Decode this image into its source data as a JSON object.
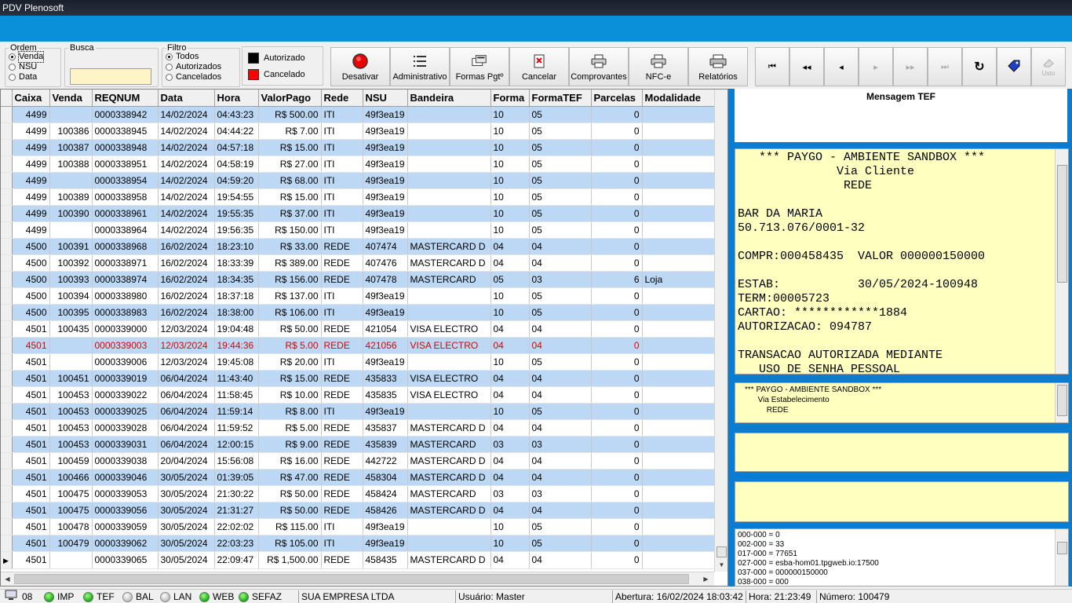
{
  "window": {
    "title": "PDV Plenosoft"
  },
  "ordem": {
    "label": "Ordem",
    "options": [
      "Venda",
      "NSU",
      "Data"
    ],
    "selected": 0
  },
  "busca": {
    "label": "Busca",
    "value": ""
  },
  "filtro": {
    "label": "Filtro",
    "options": [
      "Todos",
      "Autorizados",
      "Cancelados"
    ],
    "selected": 0
  },
  "legend": {
    "autorizado": "Autorizado",
    "cancelado": "Cancelado",
    "autorizado_color": "#000000",
    "cancelado_color": "#ff0000"
  },
  "toolbar": {
    "desativar": "Desativar",
    "administrativo": "Administrativo",
    "formas_pgt": "Formas Pgtº",
    "cancelar": "Cancelar",
    "comprovantes": "Comprovantes",
    "nfce": "NFC-e",
    "relatorios": "Relatórios"
  },
  "nav": {
    "disabled_label": "Usto"
  },
  "grid": {
    "columns": [
      "Caixa",
      "Venda",
      "REQNUM",
      "Data",
      "Hora",
      "ValorPago",
      "Rede",
      "NSU",
      "Bandeira",
      "Forma",
      "FormaTEF",
      "Parcelas",
      "Modalidade"
    ],
    "rows": [
      [
        "4499",
        "",
        "0000338942",
        "14/02/2024",
        "04:43:23",
        "R$ 500.00",
        "ITI",
        "49f3ea19",
        "",
        "10",
        "05",
        "0",
        ""
      ],
      [
        "4499",
        "100386",
        "0000338945",
        "14/02/2024",
        "04:44:22",
        "R$ 7.00",
        "ITI",
        "49f3ea19",
        "",
        "10",
        "05",
        "0",
        ""
      ],
      [
        "4499",
        "100387",
        "0000338948",
        "14/02/2024",
        "04:57:18",
        "R$ 15.00",
        "ITI",
        "49f3ea19",
        "",
        "10",
        "05",
        "0",
        ""
      ],
      [
        "4499",
        "100388",
        "0000338951",
        "14/02/2024",
        "04:58:19",
        "R$ 27.00",
        "ITI",
        "49f3ea19",
        "",
        "10",
        "05",
        "0",
        ""
      ],
      [
        "4499",
        "",
        "0000338954",
        "14/02/2024",
        "04:59:20",
        "R$ 68.00",
        "ITI",
        "49f3ea19",
        "",
        "10",
        "05",
        "0",
        ""
      ],
      [
        "4499",
        "100389",
        "0000338958",
        "14/02/2024",
        "19:54:55",
        "R$ 15.00",
        "ITI",
        "49f3ea19",
        "",
        "10",
        "05",
        "0",
        ""
      ],
      [
        "4499",
        "100390",
        "0000338961",
        "14/02/2024",
        "19:55:35",
        "R$ 37.00",
        "ITI",
        "49f3ea19",
        "",
        "10",
        "05",
        "0",
        ""
      ],
      [
        "4499",
        "",
        "0000338964",
        "14/02/2024",
        "19:56:35",
        "R$ 150.00",
        "ITI",
        "49f3ea19",
        "",
        "10",
        "05",
        "0",
        ""
      ],
      [
        "4500",
        "100391",
        "0000338968",
        "16/02/2024",
        "18:23:10",
        "R$ 33.00",
        "REDE",
        "407474",
        "MASTERCARD D",
        "04",
        "04",
        "0",
        ""
      ],
      [
        "4500",
        "100392",
        "0000338971",
        "16/02/2024",
        "18:33:39",
        "R$ 389.00",
        "REDE",
        "407476",
        "MASTERCARD D",
        "04",
        "04",
        "0",
        ""
      ],
      [
        "4500",
        "100393",
        "0000338974",
        "16/02/2024",
        "18:34:35",
        "R$ 156.00",
        "REDE",
        "407478",
        "MASTERCARD",
        "05",
        "03",
        "6",
        "Loja"
      ],
      [
        "4500",
        "100394",
        "0000338980",
        "16/02/2024",
        "18:37:18",
        "R$ 137.00",
        "ITI",
        "49f3ea19",
        "",
        "10",
        "05",
        "0",
        ""
      ],
      [
        "4500",
        "100395",
        "0000338983",
        "16/02/2024",
        "18:38:00",
        "R$ 106.00",
        "ITI",
        "49f3ea19",
        "",
        "10",
        "05",
        "0",
        ""
      ],
      [
        "4501",
        "100435",
        "0000339000",
        "12/03/2024",
        "19:04:48",
        "R$ 50.00",
        "REDE",
        "421054",
        "VISA ELECTRO",
        "04",
        "04",
        "0",
        ""
      ],
      [
        "4501",
        "",
        "0000339003",
        "12/03/2024",
        "19:44:36",
        "R$ 5.00",
        "REDE",
        "421056",
        "VISA ELECTRO",
        "04",
        "04",
        "0",
        ""
      ],
      [
        "4501",
        "",
        "0000339006",
        "12/03/2024",
        "19:45:08",
        "R$ 20.00",
        "ITI",
        "49f3ea19",
        "",
        "10",
        "05",
        "0",
        ""
      ],
      [
        "4501",
        "100451",
        "0000339019",
        "06/04/2024",
        "11:43:40",
        "R$ 15.00",
        "REDE",
        "435833",
        "VISA ELECTRO",
        "04",
        "04",
        "0",
        ""
      ],
      [
        "4501",
        "100453",
        "0000339022",
        "06/04/2024",
        "11:58:45",
        "R$ 10.00",
        "REDE",
        "435835",
        "VISA ELECTRO",
        "04",
        "04",
        "0",
        ""
      ],
      [
        "4501",
        "100453",
        "0000339025",
        "06/04/2024",
        "11:59:14",
        "R$ 8.00",
        "ITI",
        "49f3ea19",
        "",
        "10",
        "05",
        "0",
        ""
      ],
      [
        "4501",
        "100453",
        "0000339028",
        "06/04/2024",
        "11:59:52",
        "R$ 5.00",
        "REDE",
        "435837",
        "MASTERCARD D",
        "04",
        "04",
        "0",
        ""
      ],
      [
        "4501",
        "100453",
        "0000339031",
        "06/04/2024",
        "12:00:15",
        "R$ 9.00",
        "REDE",
        "435839",
        "MASTERCARD",
        "03",
        "03",
        "0",
        ""
      ],
      [
        "4501",
        "100459",
        "0000339038",
        "20/04/2024",
        "15:56:08",
        "R$ 16.00",
        "REDE",
        "442722",
        "MASTERCARD D",
        "04",
        "04",
        "0",
        ""
      ],
      [
        "4501",
        "100466",
        "0000339046",
        "30/05/2024",
        "01:39:05",
        "R$ 47.00",
        "REDE",
        "458304",
        "MASTERCARD D",
        "04",
        "04",
        "0",
        ""
      ],
      [
        "4501",
        "100475",
        "0000339053",
        "30/05/2024",
        "21:30:22",
        "R$ 50.00",
        "REDE",
        "458424",
        "MASTERCARD",
        "03",
        "03",
        "0",
        ""
      ],
      [
        "4501",
        "100475",
        "0000339056",
        "30/05/2024",
        "21:31:27",
        "R$ 50.00",
        "REDE",
        "458426",
        "MASTERCARD D",
        "04",
        "04",
        "0",
        ""
      ],
      [
        "4501",
        "100478",
        "0000339059",
        "30/05/2024",
        "22:02:02",
        "R$ 115.00",
        "ITI",
        "49f3ea19",
        "",
        "10",
        "05",
        "0",
        ""
      ],
      [
        "4501",
        "100479",
        "0000339062",
        "30/05/2024",
        "22:03:23",
        "R$ 105.00",
        "ITI",
        "49f3ea19",
        "",
        "10",
        "05",
        "0",
        ""
      ],
      [
        "4501",
        "",
        "0000339065",
        "30/05/2024",
        "22:09:47",
        "R$ 1,500.00",
        "REDE",
        "458435",
        "MASTERCARD D",
        "04",
        "04",
        "0",
        ""
      ]
    ],
    "canceled_rows": [
      14
    ],
    "current_row": 27
  },
  "tef": {
    "title": "Mensagem TEF",
    "via_cliente": "   *** PAYGO - AMBIENTE SANDBOX ***\n              Via Cliente\n               REDE\n\nBAR DA MARIA\n50.713.076/0001-32\n\nCOMPR:000458435  VALOR 000000150000\n\nESTAB:           30/05/2024-100948\nTERM:00005723\nCARTAO: ************1884\nAUTORIZACAO: 094787\n\nTRANSACAO AUTORIZADA MEDIANTE\n   USO DE SENHA PESSOAL",
    "via_estabelecimento": "*** PAYGO - AMBIENTE SANDBOX ***\n      Via Estabelecimento\n          REDE",
    "codes": "000-000 = 0\n002-000 = 33\n017-000 = 77651\n027-000 = esba-hom01.tpgweb.io:17500\n037-000 = 000000150000\n038-000 = 000"
  },
  "status": {
    "terminal": "08",
    "indicators": [
      {
        "label": "IMP",
        "on": true
      },
      {
        "label": "TEF",
        "on": true
      },
      {
        "label": "BAL",
        "on": false
      },
      {
        "label": "LAN",
        "on": false
      },
      {
        "label": "WEB",
        "on": true
      },
      {
        "label": "SEFAZ",
        "on": true
      }
    ],
    "empresa": "SUA EMPRESA LTDA",
    "usuario": "Usuário: Master",
    "abertura": "Abertura: 16/02/2024 18:03:42",
    "hora": "Hora: 21:23:49",
    "numero": "Número: 100479"
  }
}
